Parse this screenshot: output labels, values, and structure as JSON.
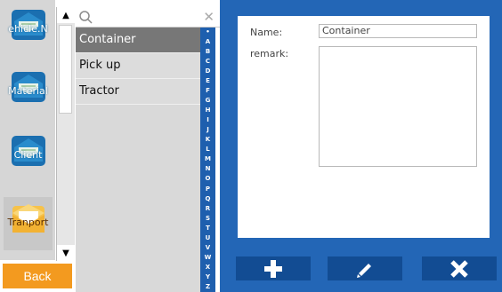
{
  "nav": {
    "items": [
      {
        "label": "ehicle.N",
        "icon": "envelope-icon"
      },
      {
        "label": "Material",
        "icon": "envelope-icon"
      },
      {
        "label": "Client",
        "icon": "envelope-icon"
      },
      {
        "label": "Tranport",
        "icon": "open-envelope-icon"
      }
    ],
    "back_label": "Back"
  },
  "search": {
    "placeholder": "",
    "value": "",
    "clear_glyph": "✕"
  },
  "list": {
    "items": [
      "Container",
      "Pick up",
      "Tractor"
    ],
    "selected": "Container"
  },
  "alpha_index": [
    "•",
    "A",
    "B",
    "C",
    "D",
    "E",
    "F",
    "G",
    "H",
    "I",
    "J",
    "K",
    "L",
    "M",
    "N",
    "O",
    "P",
    "Q",
    "R",
    "S",
    "T",
    "U",
    "V",
    "W",
    "X",
    "Y",
    "Z"
  ],
  "detail": {
    "name_label": "Name:",
    "name_value": "Container",
    "remark_label": "remark:",
    "remark_value": ""
  },
  "actions": {
    "add": "plus-icon",
    "edit": "pencil-icon",
    "delete": "close-icon"
  },
  "colors": {
    "accent_blue": "#2366b6",
    "button_blue": "#124c93",
    "back_orange": "#f39a1f",
    "index_blue": "#1e5fae"
  }
}
